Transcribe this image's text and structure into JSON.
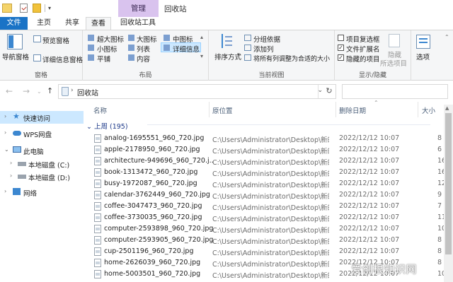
{
  "window": {
    "title": "回收站",
    "context_tab": "管理"
  },
  "tabs": {
    "file": "文件",
    "home": "主页",
    "share": "共享",
    "view": "查看",
    "recycle_tools": "回收站工具"
  },
  "ribbon": {
    "panes": {
      "label": "窗格",
      "nav_pane": "导航窗格",
      "preview_pane": "预览窗格",
      "details_pane": "详细信息窗格"
    },
    "layout": {
      "label": "布局",
      "extra_large": "超大图标",
      "large": "大图标",
      "medium": "中图标",
      "small": "小图标",
      "list": "列表",
      "details": "详细信息",
      "tiles": "平铺",
      "content": "内容"
    },
    "current_view": {
      "label": "当前视图",
      "sort_by": "排序方式",
      "group_by": "分组依据",
      "add_columns": "添加列",
      "fit_columns": "将所有列调整为合适的大小"
    },
    "show_hide": {
      "label": "显示/隐藏",
      "item_checkboxes": "项目复选框",
      "file_ext": "文件扩展名",
      "hidden_items": "隐藏的项目",
      "hide": "隐藏",
      "hide_selected": "所选项目",
      "item_checkboxes_checked": false,
      "file_ext_checked": true,
      "hidden_items_checked": true
    },
    "options": "选项"
  },
  "address": {
    "location": "回收站",
    "search_placeholder": ""
  },
  "nav_pane": {
    "items": [
      {
        "label": "快速访问",
        "icon": "star-icon"
      },
      {
        "label": "WPS网盘",
        "icon": "cloud-icon"
      },
      {
        "label": "此电脑",
        "icon": "computer-icon"
      },
      {
        "label": "本地磁盘 (C:)",
        "icon": "drive-icon"
      },
      {
        "label": "本地磁盘 (D:)",
        "icon": "drive-icon"
      },
      {
        "label": "网络",
        "icon": "network-icon"
      }
    ]
  },
  "list": {
    "columns": {
      "name": "名称",
      "original_location": "原位置",
      "date_deleted": "删除日期",
      "size": "大小"
    },
    "group": "上周 (195)",
    "rows": [
      {
        "name": "analog-1695551_960_720.jpg",
        "location": "C:\\Users\\Administrator\\Desktop\\新的...",
        "date": "2022/12/12 10:07",
        "size": "8"
      },
      {
        "name": "apple-2178950_960_720.jpg",
        "location": "C:\\Users\\Administrator\\Desktop\\新的...",
        "date": "2022/12/12 10:07",
        "size": "6"
      },
      {
        "name": "architecture-949696_960_720.j...",
        "location": "C:\\Users\\Administrator\\Desktop\\新的...",
        "date": "2022/12/12 10:07",
        "size": "16"
      },
      {
        "name": "book-1313472_960_720.jpg",
        "location": "C:\\Users\\Administrator\\Desktop\\新的...",
        "date": "2022/12/12 10:07",
        "size": "16"
      },
      {
        "name": "busy-1972087_960_720.jpg",
        "location": "C:\\Users\\Administrator\\Desktop\\新的...",
        "date": "2022/12/12 10:07",
        "size": "12"
      },
      {
        "name": "calendar-3762449_960_720.jpg",
        "location": "C:\\Users\\Administrator\\Desktop\\新的...",
        "date": "2022/12/12 10:07",
        "size": "9"
      },
      {
        "name": "coffee-3047473_960_720.jpg",
        "location": "C:\\Users\\Administrator\\Desktop\\新的...",
        "date": "2022/12/12 10:07",
        "size": "7"
      },
      {
        "name": "coffee-3730035_960_720.jpg",
        "location": "C:\\Users\\Administrator\\Desktop\\新的...",
        "date": "2022/12/12 10:07",
        "size": "11"
      },
      {
        "name": "computer-2593898_960_720.jpg",
        "location": "C:\\Users\\Administrator\\Desktop\\新的...",
        "date": "2022/12/12 10:07",
        "size": "10"
      },
      {
        "name": "computer-2593905_960_720.jpg",
        "location": "C:\\Users\\Administrator\\Desktop\\新的...",
        "date": "2022/12/12 10:07",
        "size": "8"
      },
      {
        "name": "cup-2501196_960_720.jpg",
        "location": "C:\\Users\\Administrator\\Desktop\\新的...",
        "date": "2022/12/12 10:07",
        "size": "8"
      },
      {
        "name": "home-2626039_960_720.jpg",
        "location": "C:\\Users\\Administrator\\Desktop\\新的...",
        "date": "2022/12/12 10:07",
        "size": "8"
      },
      {
        "name": "home-5003501_960_720.jpg",
        "location": "C:\\Users\\Administrator\\Desktop\\新的...",
        "date": "2022/12/12 10:07",
        "size": "10"
      }
    ]
  },
  "watermark": "爱创根知识网"
}
